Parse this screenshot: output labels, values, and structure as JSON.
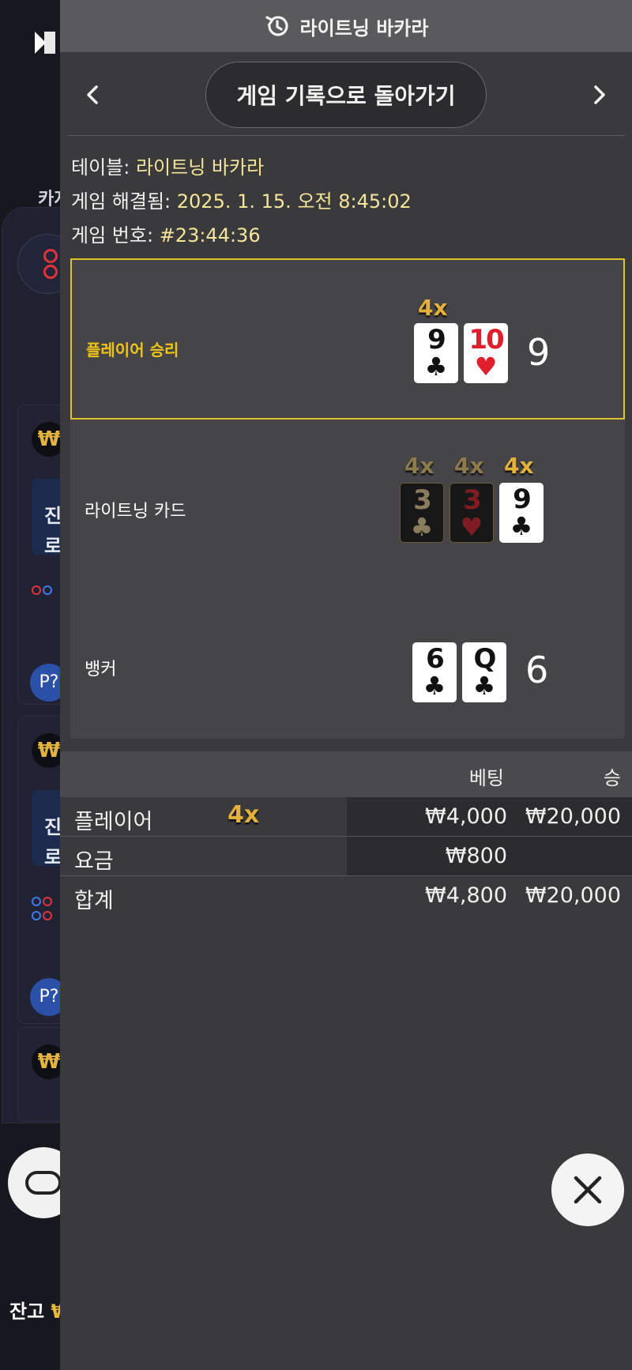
{
  "background": {
    "casino_label": "카지",
    "cards": [
      {
        "amount": "₩"
      },
      {
        "amount": "₩"
      },
      {
        "amount": "₩"
      }
    ],
    "promo_lines": [
      "진",
      "로"
    ],
    "p_button": "P?",
    "balance_label": "잔고",
    "balance_value": "₩"
  },
  "panel": {
    "title": "라이트닝 바카라",
    "back_button": "게임 기록으로 돌아가기",
    "info": {
      "table_label": "테이블:",
      "table_value": "라이트닝 바카라",
      "resolved_label": "게임 해결됨:",
      "resolved_value": "2025. 1. 15. 오전 8:45:02",
      "number_label": "게임 번호:",
      "number_value": "#23:44:36"
    },
    "outcomes": {
      "player": {
        "label": "플레이어 승리",
        "multiplier": "4x",
        "cards": [
          {
            "rank": "9",
            "suit": "♣",
            "color": "black"
          },
          {
            "rank": "10",
            "suit": "♥",
            "color": "red"
          }
        ],
        "total": "9"
      },
      "lightning": {
        "label": "라이트닝 카드",
        "cards": [
          {
            "rank": "3",
            "suit": "♣",
            "color": "black",
            "multiplier": "4x"
          },
          {
            "rank": "3",
            "suit": "♥",
            "color": "red",
            "multiplier": "4x"
          },
          {
            "rank": "9",
            "suit": "♣",
            "color": "black",
            "multiplier": "4x"
          }
        ]
      },
      "banker": {
        "label": "뱅커",
        "cards": [
          {
            "rank": "6",
            "suit": "♣",
            "color": "black"
          },
          {
            "rank": "Q",
            "suit": "♣",
            "color": "black"
          }
        ],
        "total": "6"
      }
    },
    "bets": {
      "headers": {
        "bet": "베팅",
        "win": "승"
      },
      "rows": [
        {
          "name": "플레이어",
          "multiplier": "4x",
          "bet": "₩4,000",
          "win": "₩20,000"
        },
        {
          "name": "요금",
          "bet": "₩800",
          "win": ""
        },
        {
          "name": "합계",
          "bet": "₩4,800",
          "win": "₩20,000"
        }
      ]
    }
  },
  "colors": {
    "accent_gold": "#e3b13b",
    "highlight_border": "#e1c12b",
    "panel_bg": "#3a3a3c"
  }
}
